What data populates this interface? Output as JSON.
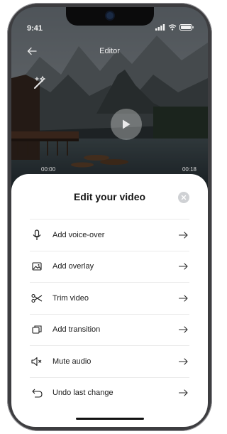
{
  "status_bar": {
    "time": "9:41"
  },
  "header": {
    "title": "Editor"
  },
  "video": {
    "time_start": "00:00",
    "time_end": "00:18"
  },
  "sheet": {
    "title": "Edit your video",
    "items": [
      {
        "label": "Add voice-over",
        "icon": "microphone-icon"
      },
      {
        "label": "Add overlay",
        "icon": "image-icon"
      },
      {
        "label": "Trim video",
        "icon": "scissors-icon"
      },
      {
        "label": "Add transition",
        "icon": "transition-icon"
      },
      {
        "label": "Mute audio",
        "icon": "speaker-mute-icon"
      },
      {
        "label": "Undo last change",
        "icon": "undo-icon"
      }
    ]
  },
  "colors": {
    "sheet_bg": "#ffffff",
    "text": "#1b1b1b",
    "divider": "#ebebeb",
    "close_bg": "#cfd1d4"
  }
}
